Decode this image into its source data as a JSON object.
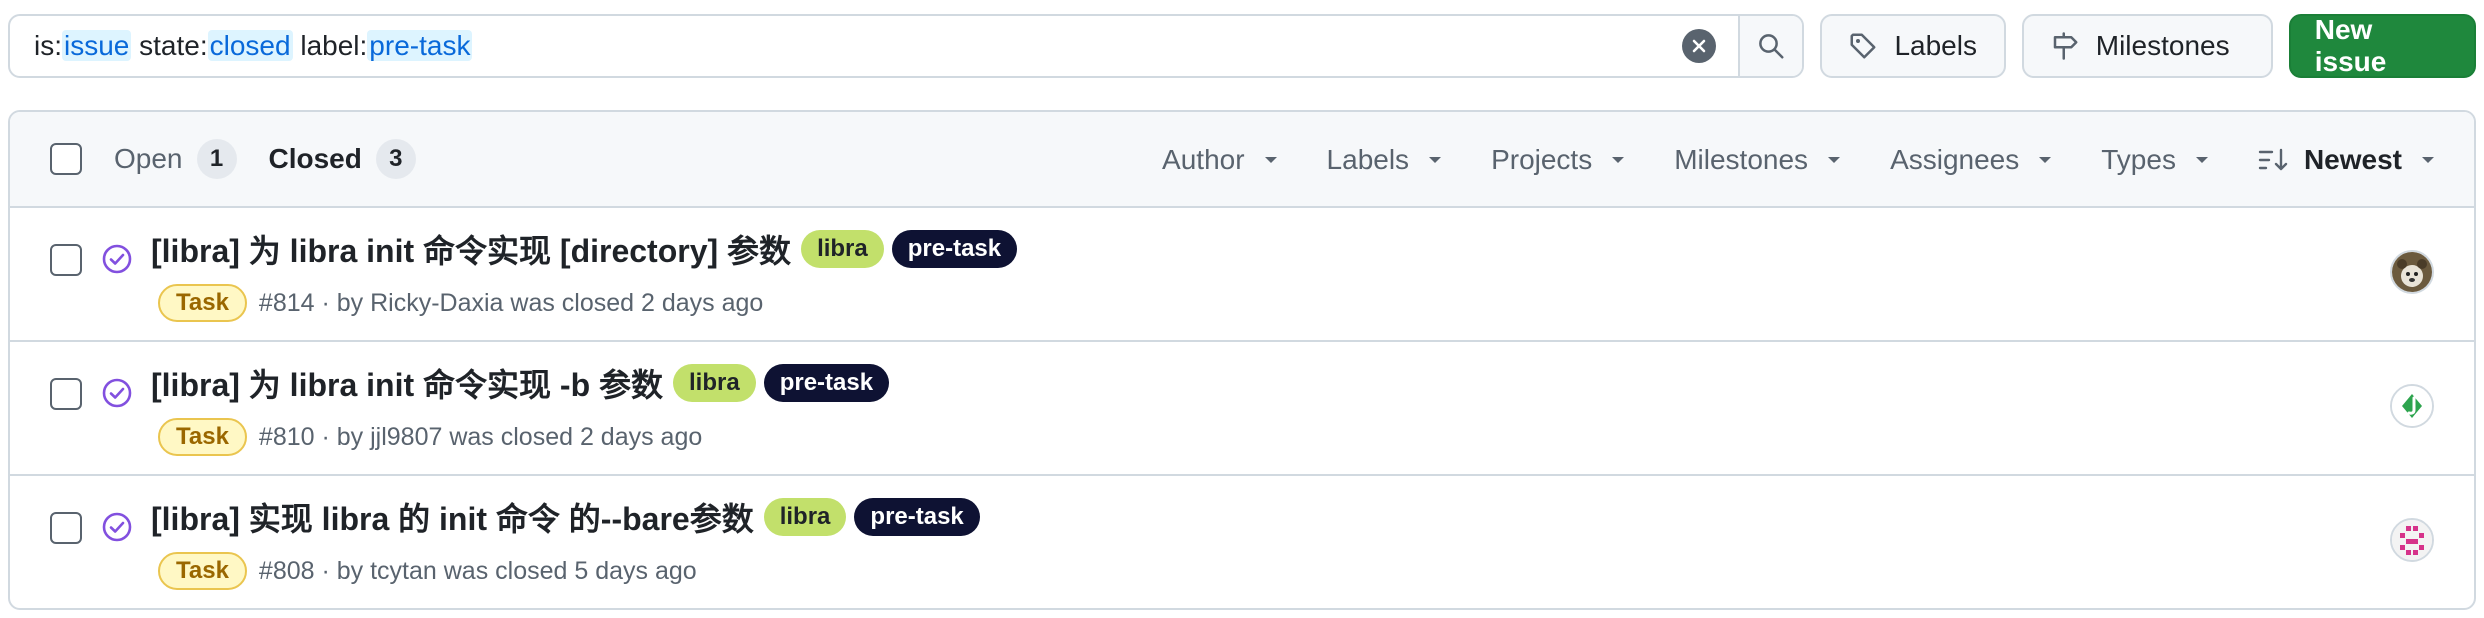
{
  "search": {
    "q1_key": "is:",
    "q1_val": "issue",
    "q2_key": "state:",
    "q2_val": "closed",
    "q3_key": "label:",
    "q3_val": "pre-task"
  },
  "toolbar": {
    "labels": "Labels",
    "milestones": "Milestones",
    "new_issue": "New issue"
  },
  "header": {
    "open_label": "Open",
    "open_count": "1",
    "closed_label": "Closed",
    "closed_count": "3",
    "filters": [
      "Author",
      "Labels",
      "Projects",
      "Milestones",
      "Assignees",
      "Types"
    ],
    "sort": "Newest"
  },
  "issues": [
    {
      "title": "[libra] 为 libra init 命令实现 [directory] 参数",
      "labels": [
        "libra",
        "pre-task"
      ],
      "type": "Task",
      "meta": "#814 · by Ricky-Daxia was closed 2 days ago",
      "avatar": "avatar-bear"
    },
    {
      "title": "[libra] 为 libra init 命令实现 -b 参数",
      "labels": [
        "libra",
        "pre-task"
      ],
      "type": "Task",
      "meta": "#810 · by jjl9807 was closed 2 days ago",
      "avatar": "avatar-green-j"
    },
    {
      "title": "[libra] 实现 libra 的 init 命令 的--bare参数",
      "labels": [
        "libra",
        "pre-task"
      ],
      "type": "Task",
      "meta": "#808 · by tcytan was closed 5 days ago",
      "avatar": "avatar-pink-identicon"
    }
  ],
  "colors": {
    "primary": "#1f883d",
    "closed_icon": "#8250df",
    "label_libra": "#c2e06b",
    "label_pretask": "#0e1233",
    "task_badge": "#9a6700"
  }
}
